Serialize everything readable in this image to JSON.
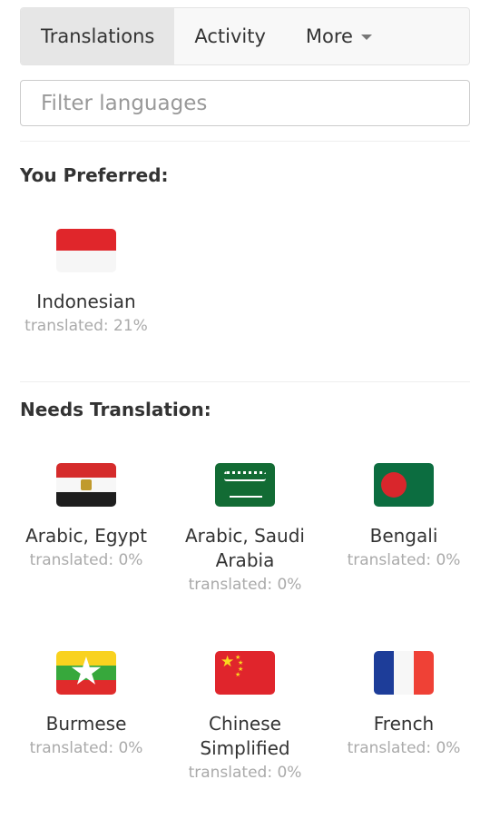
{
  "tabs": [
    {
      "label": "Translations",
      "active": true
    },
    {
      "label": "Activity",
      "active": false
    },
    {
      "label": "More",
      "active": false
    }
  ],
  "filter": {
    "placeholder": "Filter languages",
    "value": ""
  },
  "preferred": {
    "title": "You Preferred:",
    "items": [
      {
        "name": "Indonesian",
        "status": "translated: 21%",
        "flag_icon": "indonesia-flag-icon"
      }
    ]
  },
  "needs": {
    "title": "Needs Translation:",
    "items": [
      {
        "name": "Arabic, Egypt",
        "status": "translated: 0%",
        "flag_icon": "egypt-flag-icon"
      },
      {
        "name": "Arabic, Saudi Arabia",
        "status": "translated: 0%",
        "flag_icon": "saudi-arabia-flag-icon"
      },
      {
        "name": "Bengali",
        "status": "translated: 0%",
        "flag_icon": "bangladesh-flag-icon"
      },
      {
        "name": "Burmese",
        "status": "translated: 0%",
        "flag_icon": "myanmar-flag-icon"
      },
      {
        "name": "Chinese Simplified",
        "status": "translated: 0%",
        "flag_icon": "china-flag-icon"
      },
      {
        "name": "French",
        "status": "translated: 0%",
        "flag_icon": "france-flag-icon"
      }
    ]
  },
  "colors": {
    "tab_bar_bg": "#f8f8f8",
    "tab_active_bg": "#e6e6e6",
    "text": "#333333",
    "muted": "#aaaaaa"
  }
}
